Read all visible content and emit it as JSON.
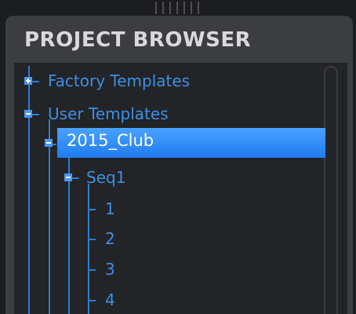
{
  "panel": {
    "title": "PROJECT BROWSER"
  },
  "tree": {
    "items": [
      {
        "label": "Factory Templates",
        "state": "collapsed"
      },
      {
        "label": "User Templates",
        "state": "expanded"
      },
      {
        "label": "2015_Club",
        "state": "expanded",
        "selected": true
      },
      {
        "label": "Seq1",
        "state": "expanded"
      },
      {
        "label": "1"
      },
      {
        "label": "2"
      },
      {
        "label": "3"
      },
      {
        "label": "4"
      }
    ]
  },
  "colors": {
    "accent": "#3d8fe6",
    "selection": "#2a8af7",
    "panel": "#3c3d40",
    "tree_bg": "#232427",
    "title": "#d9d9dc"
  },
  "icons": [
    "expand-plus-icon",
    "collapse-minus-icon",
    "resize-grip-icon"
  ]
}
